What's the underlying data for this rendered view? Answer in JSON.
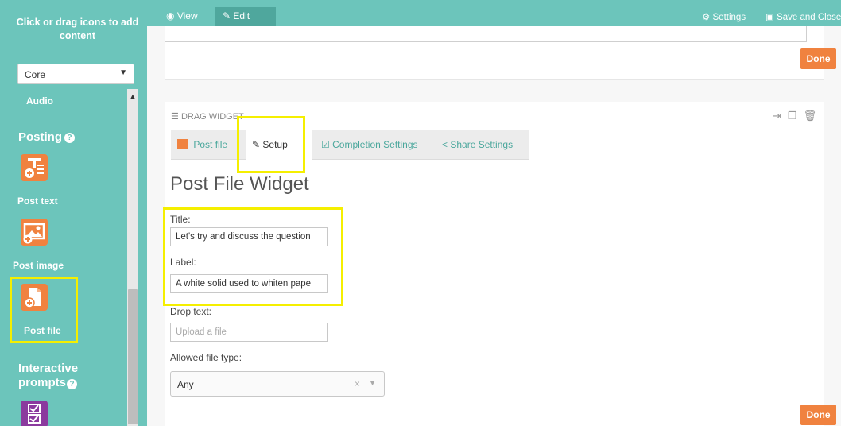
{
  "sidebar": {
    "title": "Click or drag icons to add content",
    "category": "Core",
    "items": [
      {
        "type": "label",
        "label": "Audio"
      },
      {
        "type": "section",
        "label": "Posting"
      },
      {
        "type": "widget",
        "label": "Post text",
        "icon": "post-text-icon"
      },
      {
        "type": "widget",
        "label": "Post image",
        "icon": "post-image-icon"
      },
      {
        "type": "widget",
        "label": "Post file",
        "icon": "post-file-icon"
      },
      {
        "type": "section",
        "label": "Interactive prompts"
      },
      {
        "type": "widget",
        "label": "",
        "icon": "checklist-icon"
      }
    ]
  },
  "topbar": {
    "view_label": "View",
    "edit_label": "Edit",
    "settings_label": "Settings",
    "save_label": "Save and Close"
  },
  "prev_widget": {
    "done_label": "Done"
  },
  "widget": {
    "drag_label": "DRAG WIDGET",
    "tabs": [
      {
        "label": "Post file",
        "icon": "post-file-icon"
      },
      {
        "label": "Setup",
        "icon": "pencil-icon"
      },
      {
        "label": "Completion Settings",
        "icon": "checkbox-icon"
      },
      {
        "label": "Share Settings",
        "icon": "share-icon"
      }
    ],
    "title": "Post File Widget",
    "fields": {
      "title_label": "Title:",
      "title_value": "Let's try and discuss the question",
      "label_label": "Label:",
      "label_value": "A white solid used to whiten pape",
      "drop_label": "Drop text:",
      "drop_placeholder": "Upload a file",
      "type_label": "Allowed file type:",
      "type_value": "Any"
    },
    "done_label": "Done"
  },
  "colors": {
    "teal": "#6cc5bb",
    "teal_dark": "#4fa79d",
    "orange": "#f0823f",
    "highlight": "#f5ef00"
  }
}
